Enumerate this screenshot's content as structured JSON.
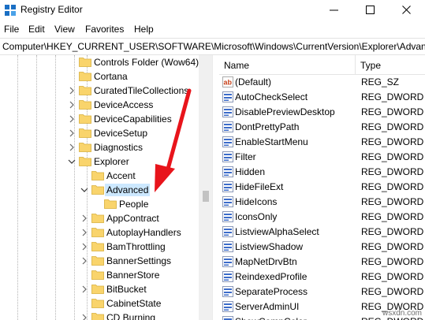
{
  "window": {
    "title": "Registry Editor",
    "icon": "registry-icon"
  },
  "menu": [
    "File",
    "Edit",
    "View",
    "Favorites",
    "Help"
  ],
  "address": "Computer\\HKEY_CURRENT_USER\\SOFTWARE\\Microsoft\\Windows\\CurrentVersion\\Explorer\\Advanced",
  "tree": [
    {
      "label": "Controls Folder (Wow64)",
      "level": 0,
      "chevron": "none"
    },
    {
      "label": "Cortana",
      "level": 0,
      "chevron": "none"
    },
    {
      "label": "CuratedTileCollections",
      "level": 0,
      "chevron": "right"
    },
    {
      "label": "DeviceAccess",
      "level": 0,
      "chevron": "right"
    },
    {
      "label": "DeviceCapabilities",
      "level": 0,
      "chevron": "right"
    },
    {
      "label": "DeviceSetup",
      "level": 0,
      "chevron": "right"
    },
    {
      "label": "Diagnostics",
      "level": 0,
      "chevron": "right"
    },
    {
      "label": "Explorer",
      "level": 0,
      "chevron": "down"
    },
    {
      "label": "Accent",
      "level": 1,
      "chevron": "none"
    },
    {
      "label": "Advanced",
      "level": 1,
      "chevron": "down",
      "selected": true
    },
    {
      "label": "People",
      "level": 2,
      "chevron": "none"
    },
    {
      "label": "AppContract",
      "level": 1,
      "chevron": "right"
    },
    {
      "label": "AutoplayHandlers",
      "level": 1,
      "chevron": "right"
    },
    {
      "label": "BamThrottling",
      "level": 1,
      "chevron": "right"
    },
    {
      "label": "BannerSettings",
      "level": 1,
      "chevron": "right"
    },
    {
      "label": "BannerStore",
      "level": 1,
      "chevron": "none"
    },
    {
      "label": "BitBucket",
      "level": 1,
      "chevron": "right"
    },
    {
      "label": "CabinetState",
      "level": 1,
      "chevron": "none"
    },
    {
      "label": "CD Burning",
      "level": 1,
      "chevron": "right"
    }
  ],
  "list": {
    "headers": {
      "name": "Name",
      "type": "Type"
    },
    "rows": [
      {
        "name": "(Default)",
        "type": "REG_SZ",
        "icon": "string-value-icon"
      },
      {
        "name": "AutoCheckSelect",
        "type": "REG_DWORD",
        "icon": "dword-value-icon"
      },
      {
        "name": "DisablePreviewDesktop",
        "type": "REG_DWORD",
        "icon": "dword-value-icon"
      },
      {
        "name": "DontPrettyPath",
        "type": "REG_DWORD",
        "icon": "dword-value-icon"
      },
      {
        "name": "EnableStartMenu",
        "type": "REG_DWORD",
        "icon": "dword-value-icon"
      },
      {
        "name": "Filter",
        "type": "REG_DWORD",
        "icon": "dword-value-icon"
      },
      {
        "name": "Hidden",
        "type": "REG_DWORD",
        "icon": "dword-value-icon"
      },
      {
        "name": "HideFileExt",
        "type": "REG_DWORD",
        "icon": "dword-value-icon"
      },
      {
        "name": "HideIcons",
        "type": "REG_DWORD",
        "icon": "dword-value-icon"
      },
      {
        "name": "IconsOnly",
        "type": "REG_DWORD",
        "icon": "dword-value-icon"
      },
      {
        "name": "ListviewAlphaSelect",
        "type": "REG_DWORD",
        "icon": "dword-value-icon"
      },
      {
        "name": "ListviewShadow",
        "type": "REG_DWORD",
        "icon": "dword-value-icon"
      },
      {
        "name": "MapNetDrvBtn",
        "type": "REG_DWORD",
        "icon": "dword-value-icon"
      },
      {
        "name": "ReindexedProfile",
        "type": "REG_DWORD",
        "icon": "dword-value-icon"
      },
      {
        "name": "SeparateProcess",
        "type": "REG_DWORD",
        "icon": "dword-value-icon"
      },
      {
        "name": "ServerAdminUI",
        "type": "REG_DWORD",
        "icon": "dword-value-icon"
      },
      {
        "name": "ShowCompColor",
        "type": "REG_DWORD",
        "icon": "dword-value-icon"
      }
    ]
  },
  "watermark": "wsxdn.com",
  "colors": {
    "folder": "#f9d46c",
    "selection": "#cce8ff",
    "arrow": "#e8141b"
  }
}
